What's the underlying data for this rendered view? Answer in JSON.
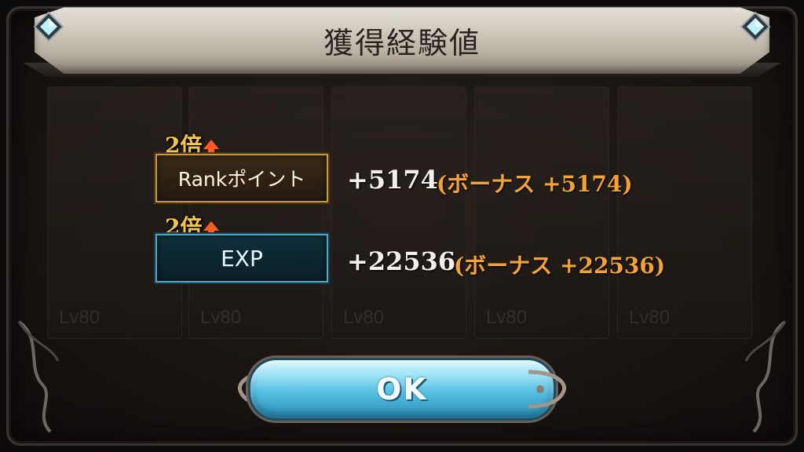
{
  "dialog": {
    "title": "獲得経験値"
  },
  "background_cards": [
    {
      "level": "Lv80"
    },
    {
      "level": "Lv80"
    },
    {
      "level": "Lv80"
    },
    {
      "level": "Lv80"
    },
    {
      "level": "Lv80"
    }
  ],
  "rows": [
    {
      "multiplier": "2倍",
      "label": "Rankポイント",
      "value": "+5174",
      "bonus": "(ボーナス +5174)"
    },
    {
      "multiplier": "2倍",
      "label": "EXP",
      "value": "+22536",
      "bonus": "(ボーナス +22536)"
    }
  ],
  "ok_button": {
    "label": "OK"
  },
  "colors": {
    "rank_border": "#c6993d",
    "exp_border": "#58a6bd",
    "bonus_text": "#f3a236",
    "multiplier_text": "#f6c64a",
    "ok_button": "#56bfe2"
  }
}
